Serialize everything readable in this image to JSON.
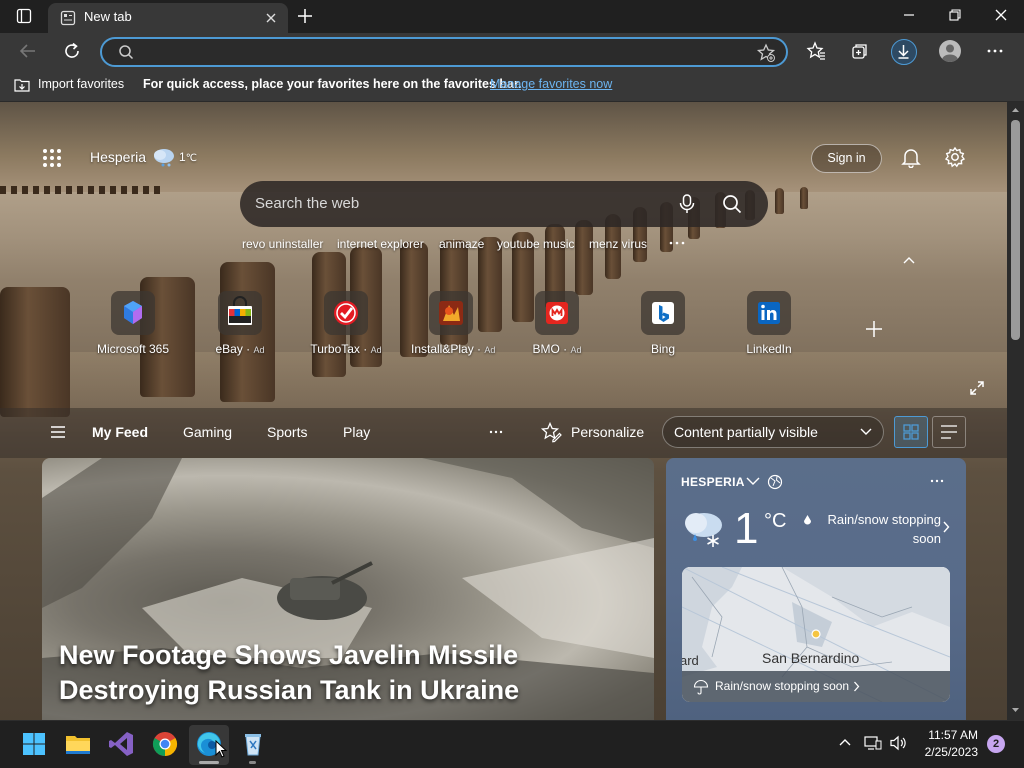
{
  "browser": {
    "tab_title": "New tab",
    "favorites_bar": {
      "import_label": "Import favorites",
      "message": "For quick access, place your favorites here on the favorites bar.",
      "manage_link": "Manage favorites now"
    },
    "address_placeholder": ""
  },
  "ntp": {
    "location": "Hesperia",
    "temperature": "1",
    "temp_unit": "℃",
    "sign_in": "Sign in",
    "search_placeholder": "Search the web",
    "trending": [
      "revo uninstaller",
      "internet explorer",
      "animaze",
      "youtube music",
      "menz virus"
    ],
    "quick_links": [
      {
        "label": "Microsoft 365",
        "ad": ""
      },
      {
        "label": "eBay",
        "ad": "Ad"
      },
      {
        "label": "TurboTax",
        "ad": "Ad"
      },
      {
        "label": "Install&Play",
        "ad": "Ad"
      },
      {
        "label": "BMO",
        "ad": "Ad"
      },
      {
        "label": "Bing",
        "ad": ""
      },
      {
        "label": "LinkedIn",
        "ad": ""
      }
    ],
    "feed_tabs": [
      "My Feed",
      "Gaming",
      "Sports",
      "Play"
    ],
    "personalize": "Personalize",
    "content_visibility": "Content partially visible"
  },
  "hero_card": {
    "headline": "New Footage Shows Javelin Missile Destroying Russian Tank in Ukraine"
  },
  "weather_card": {
    "location": "HESPERIA",
    "temperature": "1",
    "unit": "°C",
    "condition": "Rain/snow stopping soon",
    "map_label_left": "ard",
    "map_city": "San Bernardino",
    "map_banner": "Rain/snow stopping soon"
  },
  "taskbar": {
    "time": "11:57 AM",
    "date": "2/25/2023",
    "notification_count": "2"
  },
  "colors": {
    "accent": "#4d9ad4",
    "link": "#6cb4f0",
    "chrome_bg": "#383838",
    "taskbar_bg": "#202020"
  }
}
